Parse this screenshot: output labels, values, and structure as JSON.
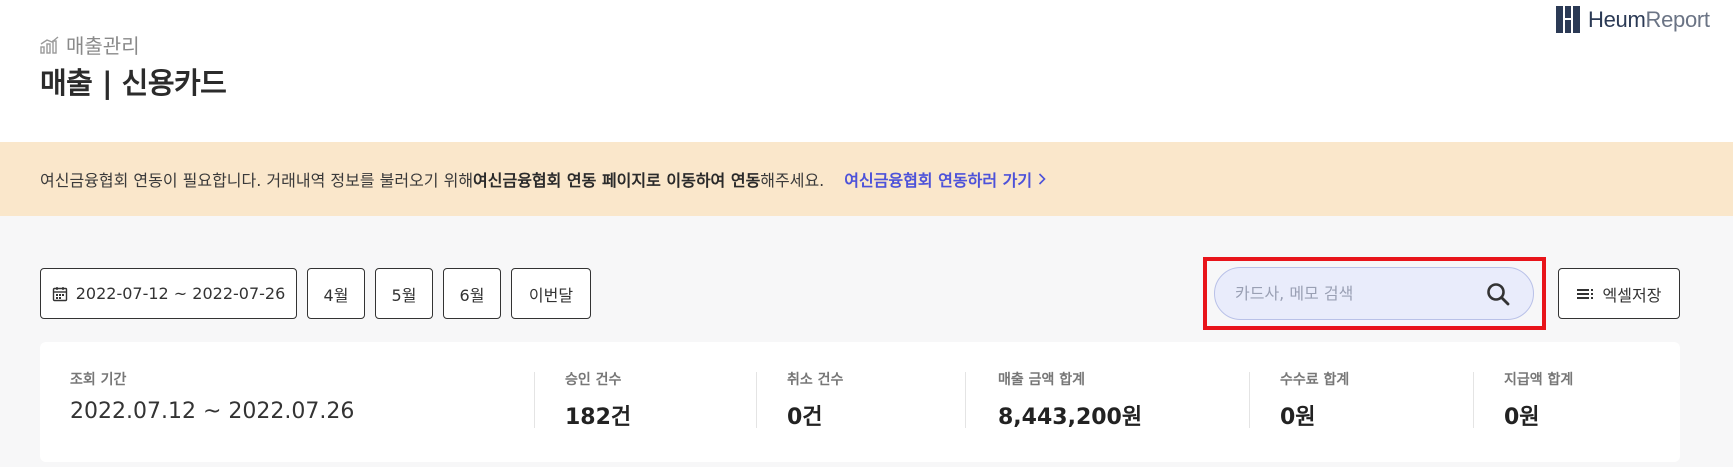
{
  "header": {
    "breadcrumb": "매출관리",
    "title": "매출 | 신용카드",
    "breadcrumb_icon": "bar-chart-icon"
  },
  "logo": {
    "brand": "Heum",
    "product": "Report",
    "icon": "logo-mark-icon"
  },
  "notice": {
    "text_prefix": "여신금융협회 연동이 필요합니다. 거래내역 정보를 불러오기 위해 ",
    "text_bold": "여신금융협회 연동 페이지로 이동하여 연동",
    "text_suffix": "해주세요.",
    "link_label": "여신금융협회 연동하러 가기",
    "link_color": "#4d52d9",
    "background": "#fae7cb"
  },
  "toolbar": {
    "date_range": "2022-07-12 ~ 2022-07-26",
    "month_buttons": [
      "4월",
      "5월",
      "6월",
      "이번달"
    ],
    "search_placeholder": "카드사, 메모 검색",
    "excel_label": "엑셀저장",
    "highlight_color": "#e8141a"
  },
  "summary": {
    "items": [
      {
        "label": "조회 기간",
        "value": "2022.07.12 ~ 2022.07.26"
      },
      {
        "label": "승인 건수",
        "value": "182건"
      },
      {
        "label": "취소 건수",
        "value": "0건"
      },
      {
        "label": "매출 금액 합계",
        "value": "8,443,200원"
      },
      {
        "label": "수수료 합계",
        "value": "0원"
      },
      {
        "label": "지급액 합계",
        "value": "0원"
      }
    ]
  }
}
